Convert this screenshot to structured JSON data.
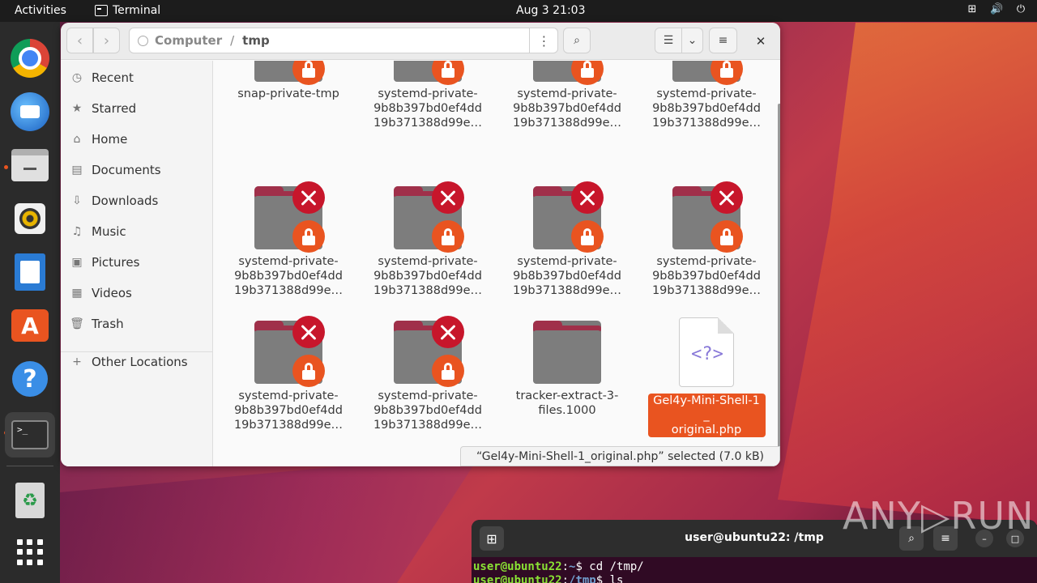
{
  "topbar": {
    "activities": "Activities",
    "app_name": "Terminal",
    "clock": "Aug 3  21:03"
  },
  "dock": {
    "items": [
      "chrome-icon",
      "thunderbird-icon",
      "files-icon",
      "rhythmbox-icon",
      "libreoffice-writer-icon",
      "app-center-icon",
      "help-icon",
      "terminal-icon",
      "trash-icon",
      "show-apps-icon"
    ]
  },
  "file_manager": {
    "path": {
      "root": "Computer",
      "separator": "/",
      "current": "tmp"
    },
    "sidebar": {
      "items": [
        "Recent",
        "Starred",
        "Home",
        "Documents",
        "Downloads",
        "Music",
        "Pictures",
        "Videos",
        "Trash"
      ],
      "other": "Other Locations"
    },
    "files": [
      {
        "line1": "snap-private-tmp",
        "line2": "",
        "line3": ""
      },
      {
        "line1": "systemd-private-",
        "line2": "9b8b397bd0ef4dd",
        "line3": "19b371388d99e…"
      },
      {
        "line1": "systemd-private-",
        "line2": "9b8b397bd0ef4dd",
        "line3": "19b371388d99e…"
      },
      {
        "line1": "systemd-private-",
        "line2": "9b8b397bd0ef4dd",
        "line3": "19b371388d99e…"
      },
      {
        "line1": "systemd-private-",
        "line2": "9b8b397bd0ef4dd",
        "line3": "19b371388d99e…"
      },
      {
        "line1": "systemd-private-",
        "line2": "9b8b397bd0ef4dd",
        "line3": "19b371388d99e…"
      },
      {
        "line1": "systemd-private-",
        "line2": "9b8b397bd0ef4dd",
        "line3": "19b371388d99e…"
      },
      {
        "line1": "systemd-private-",
        "line2": "9b8b397bd0ef4dd",
        "line3": "19b371388d99e…"
      },
      {
        "line1": "systemd-private-",
        "line2": "9b8b397bd0ef4dd",
        "line3": "19b371388d99e…"
      },
      {
        "line1": "systemd-private-",
        "line2": "9b8b397bd0ef4dd",
        "line3": "19b371388d99e…"
      },
      {
        "line1": "tracker-extract-3-",
        "line2": "files.1000",
        "line3": ""
      },
      {
        "line1": "Gel4y-Mini-Shell-1_",
        "line2": "original.php",
        "line3": ""
      }
    ],
    "php_glyph": "<?>",
    "status": "“Gel4y-Mini-Shell-1_original.php” selected (7.0 kB)"
  },
  "terminal": {
    "title": "user@ubuntu22: /tmp",
    "line1_user": "user@ubuntu22",
    "line1_sep": ":",
    "line1_path": "~",
    "line1_cmd": "$ cd /tmp/",
    "line2_user": "user@ubuntu22",
    "line2_sep": ":",
    "line2_path": "/tmp",
    "line2_cmd": "$ ls"
  },
  "watermark": "ANY▷RUN",
  "colors": {
    "accent": "#e95420",
    "error_badge": "#c7162b",
    "folder_tab": "#a0304a"
  }
}
